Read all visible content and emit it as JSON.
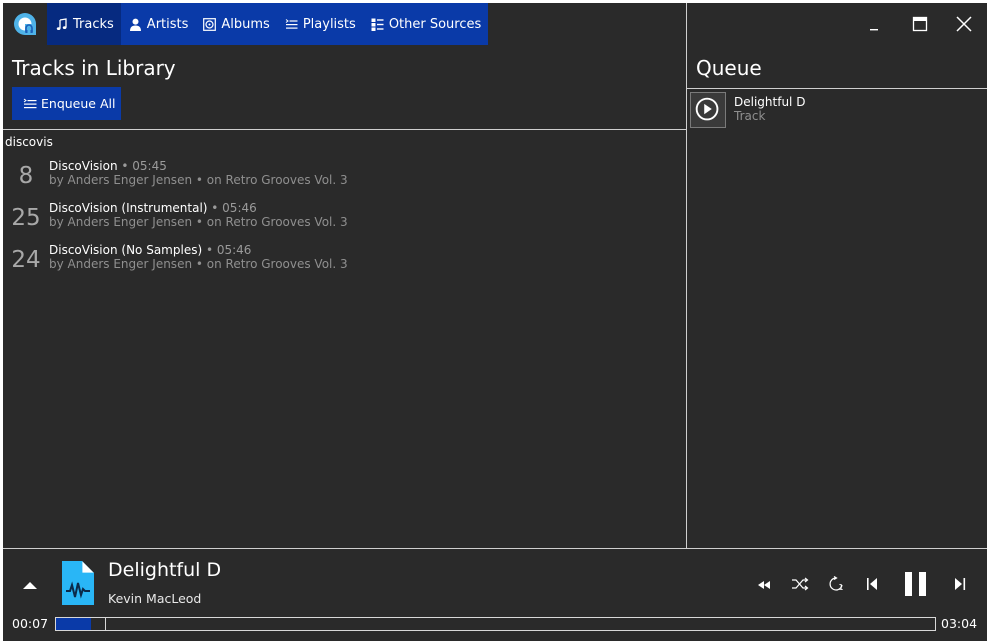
{
  "nav": {
    "tabs": [
      {
        "label": "Tracks",
        "icon": "music-note-icon",
        "active": true
      },
      {
        "label": "Artists",
        "icon": "person-icon",
        "active": false
      },
      {
        "label": "Albums",
        "icon": "album-icon",
        "active": false
      },
      {
        "label": "Playlists",
        "icon": "playlist-icon",
        "active": false
      },
      {
        "label": "Other Sources",
        "icon": "sources-icon",
        "active": false
      }
    ]
  },
  "library": {
    "title": "Tracks in Library",
    "enqueue_label": "Enqueue All",
    "search_value": "discovis",
    "tracks": [
      {
        "number": "8",
        "title": "DiscoVision",
        "duration": " • 05:45",
        "meta": "by Anders Enger Jensen • on Retro Grooves Vol. 3"
      },
      {
        "number": "25",
        "title": "DiscoVision (Instrumental)",
        "duration": " • 05:46",
        "meta": "by Anders Enger Jensen • on Retro Grooves Vol. 3"
      },
      {
        "number": "24",
        "title": "DiscoVision (No Samples)",
        "duration": " • 05:46",
        "meta": "by Anders Enger Jensen • on Retro Grooves Vol. 3"
      }
    ]
  },
  "queue": {
    "title": "Queue",
    "items": [
      {
        "name": "Delightful D",
        "kind": "Track"
      }
    ]
  },
  "player": {
    "title": "Delightful D",
    "artist": "Kevin MacLeod",
    "elapsed": "00:07",
    "total": "03:04",
    "progress_fraction": 0.04
  },
  "colors": {
    "accent": "#0a3aa8",
    "background": "#2a2a2a",
    "art": "#29b6f6"
  }
}
